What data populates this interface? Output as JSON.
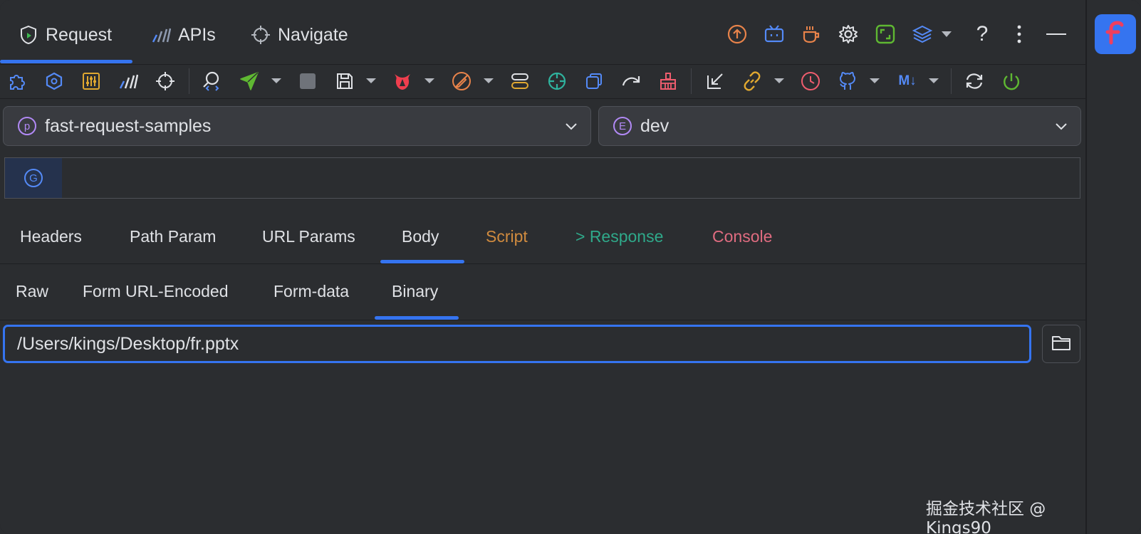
{
  "top_tabs": [
    {
      "label": "Request",
      "icon": "shield-play-icon"
    },
    {
      "label": "APIs",
      "icon": "bars-icon"
    },
    {
      "label": "Navigate",
      "icon": "crosshair-icon"
    }
  ],
  "top_icons": [
    "upload-icon",
    "tv-icon",
    "coffee-icon",
    "gear-icon",
    "expand-icon",
    "layers-icon",
    "chevron-down-icon",
    "help-icon",
    "more-icon",
    "minimize-icon"
  ],
  "help_label": "?",
  "toolbar_icons": [
    "puzzle-icon",
    "hexagon-icon",
    "sliders-icon",
    "bars-chart-icon",
    "target-icon",
    "search-code-icon",
    "send-icon",
    "stop-icon",
    "save-icon",
    "angular-icon",
    "no-edit-icon",
    "toggle-icon",
    "crosshair-green-icon",
    "copy-icon",
    "redo-icon",
    "broom-icon",
    "import-icon",
    "link-icon",
    "clock-icon",
    "github-icon",
    "markdown-icon",
    "sync-icon",
    "power-icon"
  ],
  "markdown_label": "M↓",
  "project_select": {
    "badge": "p",
    "value": "fast-request-samples"
  },
  "env_select": {
    "badge": "E",
    "value": "dev"
  },
  "method_badge": "G",
  "tabs": [
    {
      "label": "Headers",
      "color": "#dfe1e5"
    },
    {
      "label": "Path Param",
      "color": "#dfe1e5"
    },
    {
      "label": "URL Params",
      "color": "#dfe1e5"
    },
    {
      "label": "Body",
      "color": "#dfe1e5"
    },
    {
      "label": "Script",
      "color": "#d08b3f"
    },
    {
      "label": "> Response",
      "color": "#2fa98a"
    },
    {
      "label": "Console",
      "color": "#e06c80"
    }
  ],
  "active_tab": "Body",
  "body_tabs": [
    "Raw",
    "Form URL-Encoded",
    "Form-data",
    "Binary"
  ],
  "active_body_tab": "Binary",
  "binary_path": "/Users/kings/Desktop/fr.pptx",
  "watermark": "掘金技术社区 @ Kings90",
  "accent_color": "#3574f0"
}
